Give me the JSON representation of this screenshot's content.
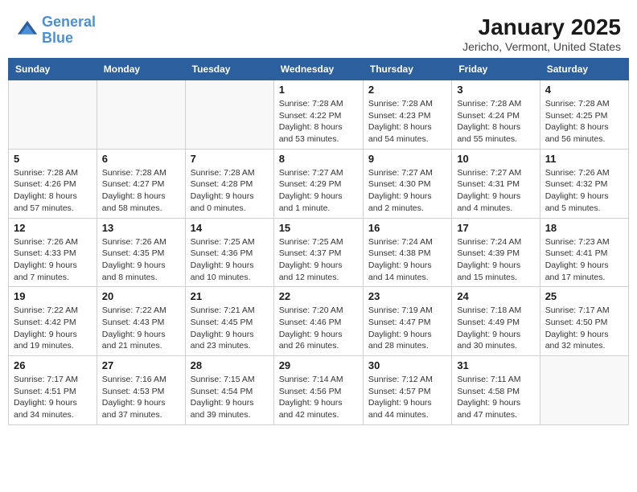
{
  "header": {
    "logo_line1": "General",
    "logo_line2": "Blue",
    "month_title": "January 2025",
    "location": "Jericho, Vermont, United States"
  },
  "days_of_week": [
    "Sunday",
    "Monday",
    "Tuesday",
    "Wednesday",
    "Thursday",
    "Friday",
    "Saturday"
  ],
  "weeks": [
    {
      "cells": [
        {
          "day": "",
          "empty": true
        },
        {
          "day": "",
          "empty": true
        },
        {
          "day": "",
          "empty": true
        },
        {
          "day": "1",
          "info": "Sunrise: 7:28 AM\nSunset: 4:22 PM\nDaylight: 8 hours\nand 53 minutes."
        },
        {
          "day": "2",
          "info": "Sunrise: 7:28 AM\nSunset: 4:23 PM\nDaylight: 8 hours\nand 54 minutes."
        },
        {
          "day": "3",
          "info": "Sunrise: 7:28 AM\nSunset: 4:24 PM\nDaylight: 8 hours\nand 55 minutes."
        },
        {
          "day": "4",
          "info": "Sunrise: 7:28 AM\nSunset: 4:25 PM\nDaylight: 8 hours\nand 56 minutes."
        }
      ]
    },
    {
      "cells": [
        {
          "day": "5",
          "info": "Sunrise: 7:28 AM\nSunset: 4:26 PM\nDaylight: 8 hours\nand 57 minutes."
        },
        {
          "day": "6",
          "info": "Sunrise: 7:28 AM\nSunset: 4:27 PM\nDaylight: 8 hours\nand 58 minutes."
        },
        {
          "day": "7",
          "info": "Sunrise: 7:28 AM\nSunset: 4:28 PM\nDaylight: 9 hours\nand 0 minutes."
        },
        {
          "day": "8",
          "info": "Sunrise: 7:27 AM\nSunset: 4:29 PM\nDaylight: 9 hours\nand 1 minute."
        },
        {
          "day": "9",
          "info": "Sunrise: 7:27 AM\nSunset: 4:30 PM\nDaylight: 9 hours\nand 2 minutes."
        },
        {
          "day": "10",
          "info": "Sunrise: 7:27 AM\nSunset: 4:31 PM\nDaylight: 9 hours\nand 4 minutes."
        },
        {
          "day": "11",
          "info": "Sunrise: 7:26 AM\nSunset: 4:32 PM\nDaylight: 9 hours\nand 5 minutes."
        }
      ]
    },
    {
      "cells": [
        {
          "day": "12",
          "info": "Sunrise: 7:26 AM\nSunset: 4:33 PM\nDaylight: 9 hours\nand 7 minutes."
        },
        {
          "day": "13",
          "info": "Sunrise: 7:26 AM\nSunset: 4:35 PM\nDaylight: 9 hours\nand 8 minutes."
        },
        {
          "day": "14",
          "info": "Sunrise: 7:25 AM\nSunset: 4:36 PM\nDaylight: 9 hours\nand 10 minutes."
        },
        {
          "day": "15",
          "info": "Sunrise: 7:25 AM\nSunset: 4:37 PM\nDaylight: 9 hours\nand 12 minutes."
        },
        {
          "day": "16",
          "info": "Sunrise: 7:24 AM\nSunset: 4:38 PM\nDaylight: 9 hours\nand 14 minutes."
        },
        {
          "day": "17",
          "info": "Sunrise: 7:24 AM\nSunset: 4:39 PM\nDaylight: 9 hours\nand 15 minutes."
        },
        {
          "day": "18",
          "info": "Sunrise: 7:23 AM\nSunset: 4:41 PM\nDaylight: 9 hours\nand 17 minutes."
        }
      ]
    },
    {
      "cells": [
        {
          "day": "19",
          "info": "Sunrise: 7:22 AM\nSunset: 4:42 PM\nDaylight: 9 hours\nand 19 minutes."
        },
        {
          "day": "20",
          "info": "Sunrise: 7:22 AM\nSunset: 4:43 PM\nDaylight: 9 hours\nand 21 minutes."
        },
        {
          "day": "21",
          "info": "Sunrise: 7:21 AM\nSunset: 4:45 PM\nDaylight: 9 hours\nand 23 minutes."
        },
        {
          "day": "22",
          "info": "Sunrise: 7:20 AM\nSunset: 4:46 PM\nDaylight: 9 hours\nand 26 minutes."
        },
        {
          "day": "23",
          "info": "Sunrise: 7:19 AM\nSunset: 4:47 PM\nDaylight: 9 hours\nand 28 minutes."
        },
        {
          "day": "24",
          "info": "Sunrise: 7:18 AM\nSunset: 4:49 PM\nDaylight: 9 hours\nand 30 minutes."
        },
        {
          "day": "25",
          "info": "Sunrise: 7:17 AM\nSunset: 4:50 PM\nDaylight: 9 hours\nand 32 minutes."
        }
      ]
    },
    {
      "cells": [
        {
          "day": "26",
          "info": "Sunrise: 7:17 AM\nSunset: 4:51 PM\nDaylight: 9 hours\nand 34 minutes."
        },
        {
          "day": "27",
          "info": "Sunrise: 7:16 AM\nSunset: 4:53 PM\nDaylight: 9 hours\nand 37 minutes."
        },
        {
          "day": "28",
          "info": "Sunrise: 7:15 AM\nSunset: 4:54 PM\nDaylight: 9 hours\nand 39 minutes."
        },
        {
          "day": "29",
          "info": "Sunrise: 7:14 AM\nSunset: 4:56 PM\nDaylight: 9 hours\nand 42 minutes."
        },
        {
          "day": "30",
          "info": "Sunrise: 7:12 AM\nSunset: 4:57 PM\nDaylight: 9 hours\nand 44 minutes."
        },
        {
          "day": "31",
          "info": "Sunrise: 7:11 AM\nSunset: 4:58 PM\nDaylight: 9 hours\nand 47 minutes."
        },
        {
          "day": "",
          "empty": true
        }
      ]
    }
  ]
}
